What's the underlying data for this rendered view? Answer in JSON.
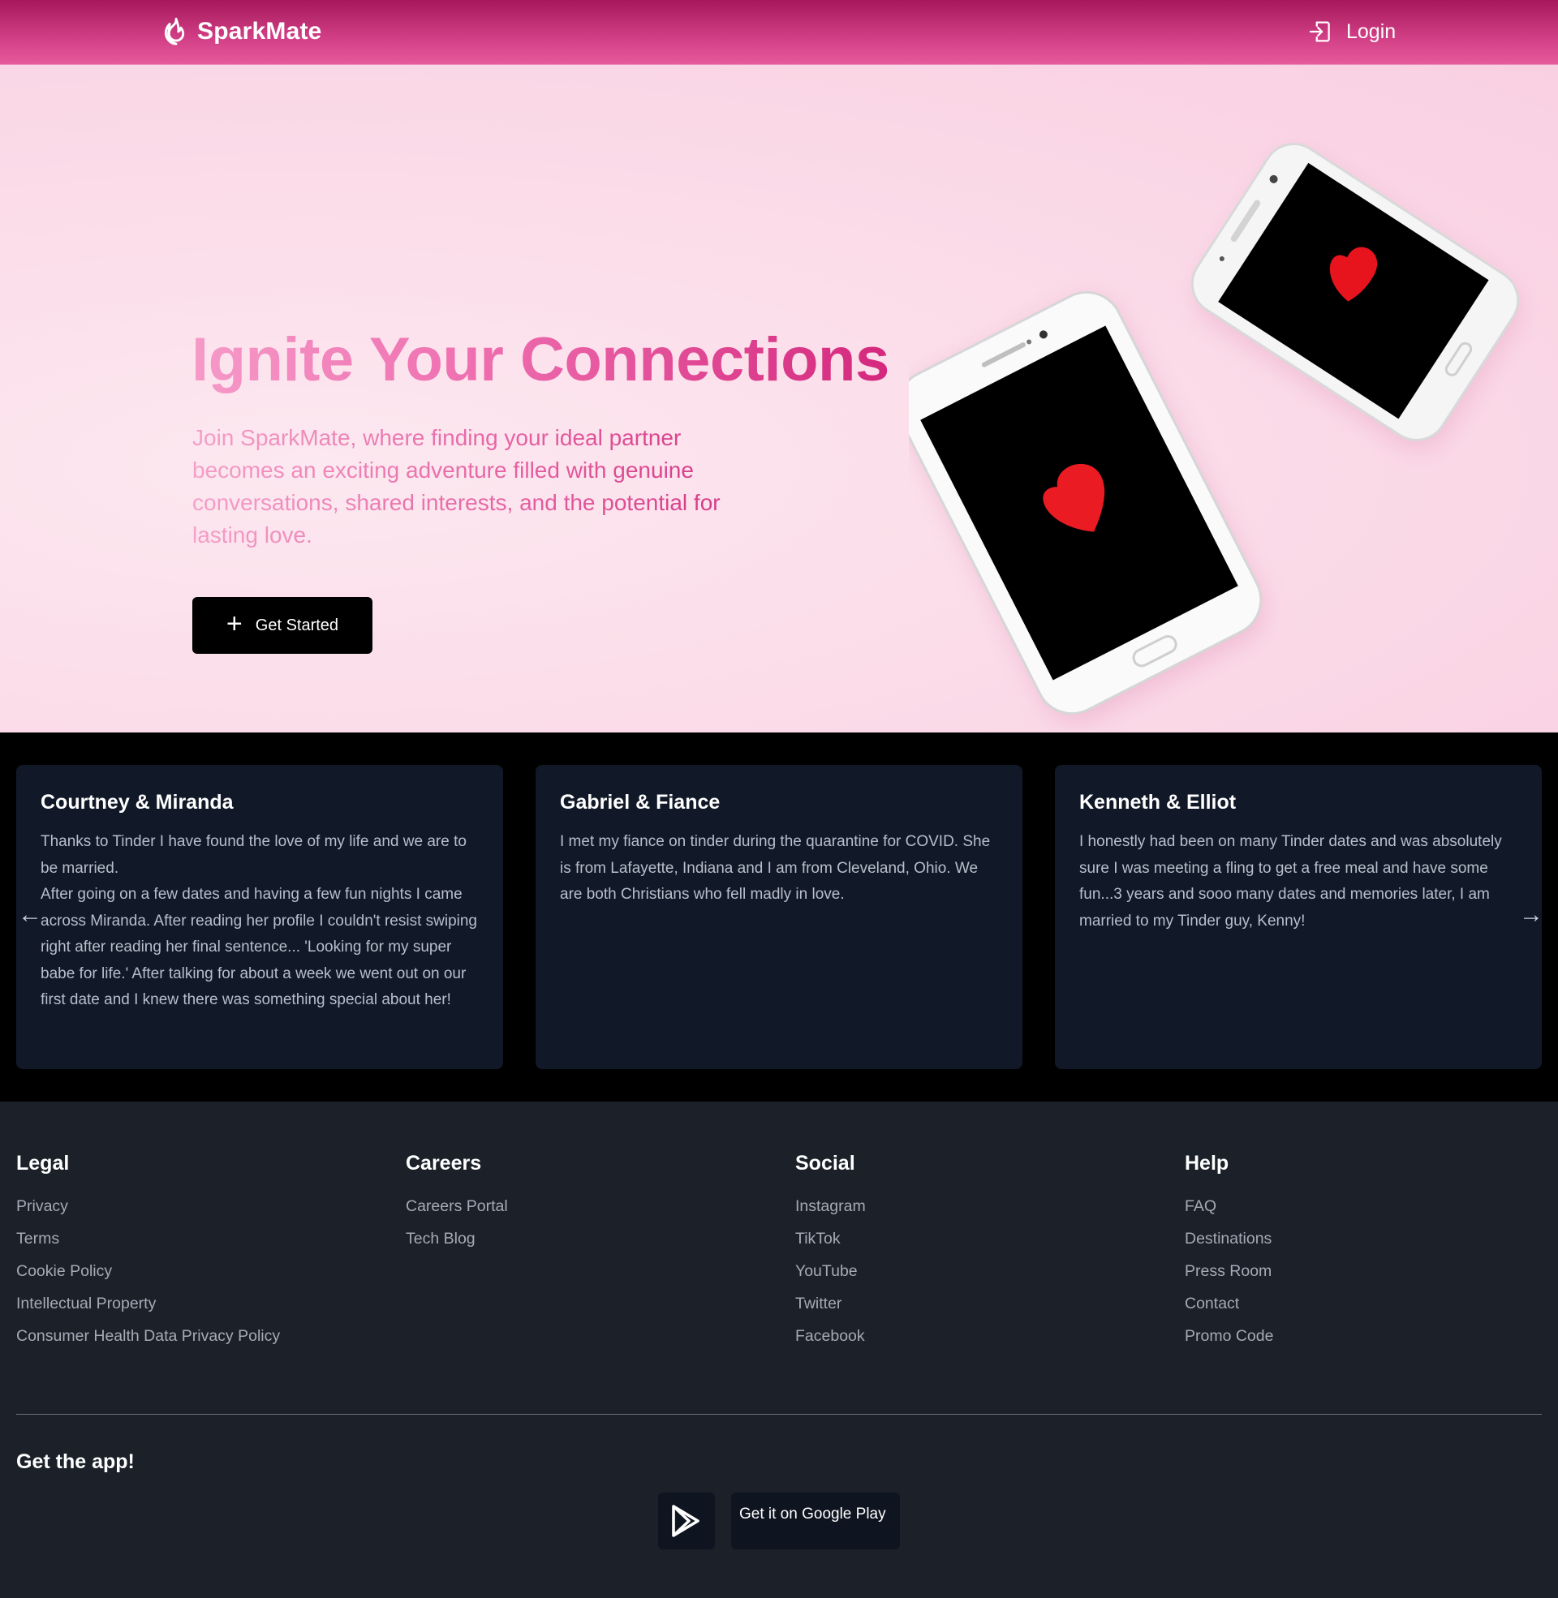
{
  "header": {
    "brand": "SparkMate",
    "login_label": "Login"
  },
  "hero": {
    "title": "Ignite Your Connections",
    "subtitle": "Join SparkMate, where finding your ideal partner becomes an exciting adventure filled with genuine conversations, shared interests, and the potential for lasting love.",
    "cta_label": "Get Started",
    "cta_icon": "plus-icon"
  },
  "testimonials": [
    {
      "name": "Courtney & Miranda",
      "text": "Thanks to Tinder I have found the love of my life and we are to be married.\nAfter going on a few dates and having a few fun nights I came across Miranda. After reading her profile I couldn't resist swiping right after reading her final sentence... 'Looking for my super babe for life.' After talking for about a week we went out on our first date and I knew there was something special about her!"
    },
    {
      "name": "Gabriel & Fiance",
      "text": "I met my fiance on tinder during the quarantine for COVID. She is from Lafayette, Indiana and I am from Cleveland, Ohio. We are both Christians who fell madly in love."
    },
    {
      "name": "Kenneth & Elliot",
      "text": "I honestly had been on many Tinder dates and was absolutely sure I was meeting a fling to get a free meal and have some fun...3 years and sooo many dates and memories later, I am married to my Tinder guy, Kenny!"
    }
  ],
  "footer": {
    "columns": [
      {
        "title": "Legal",
        "links": [
          "Privacy",
          "Terms",
          "Cookie Policy",
          "Intellectual Property",
          "Consumer Health Data Privacy Policy"
        ]
      },
      {
        "title": "Careers",
        "links": [
          "Careers Portal",
          "Tech Blog"
        ]
      },
      {
        "title": "Social",
        "links": [
          "Instagram",
          "TikTok",
          "YouTube",
          "Twitter",
          "Facebook"
        ]
      },
      {
        "title": "Help",
        "links": [
          "FAQ",
          "Destinations",
          "Press Room",
          "Contact",
          "Promo Code"
        ]
      }
    ],
    "get_app": "Get the app!",
    "google_play_label": "Get it on Google Play"
  },
  "colors": {
    "header_pink": "#d23f86",
    "hero_bg": "#fbdde9",
    "card_bg": "#111827",
    "footer_bg": "#1b2029"
  }
}
